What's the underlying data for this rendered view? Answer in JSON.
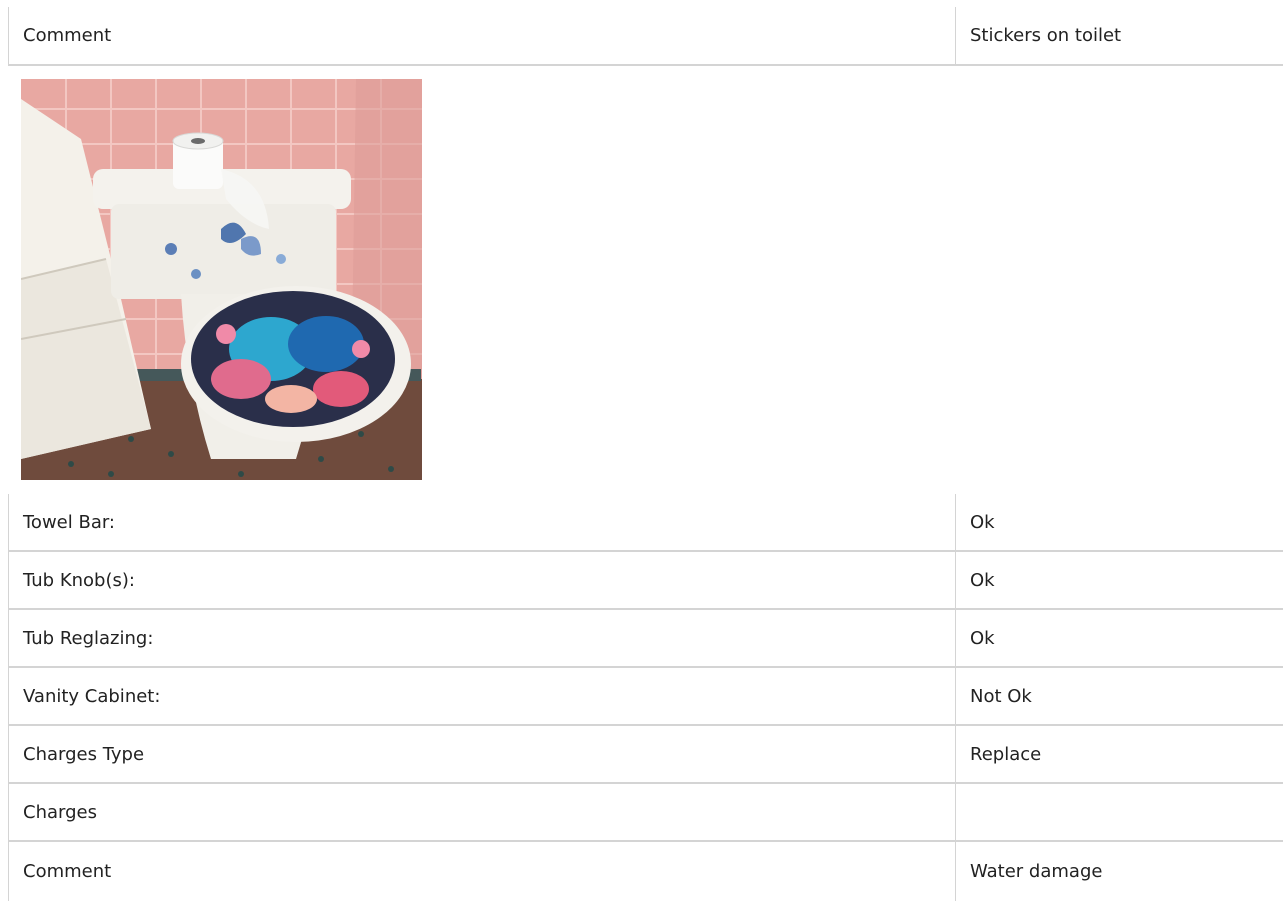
{
  "top_row": {
    "label": "Comment",
    "value": "Stickers on toilet"
  },
  "photo": {
    "icon": "toilet-photo",
    "colors": {
      "wall": "#e9a9a4",
      "floor": "#6e4a3c",
      "porcelain": "#f3f1ec"
    }
  },
  "rows": [
    {
      "label": "Towel Bar:",
      "value": "Ok"
    },
    {
      "label": "Tub Knob(s):",
      "value": "Ok"
    },
    {
      "label": "Tub Reglazing:",
      "value": "Ok"
    },
    {
      "label": "Vanity Cabinet:",
      "value": "Not Ok"
    },
    {
      "label": "Charges Type",
      "value": "Replace"
    },
    {
      "label": "Charges",
      "value": ""
    },
    {
      "label": "Comment",
      "value": "Water damage"
    }
  ]
}
